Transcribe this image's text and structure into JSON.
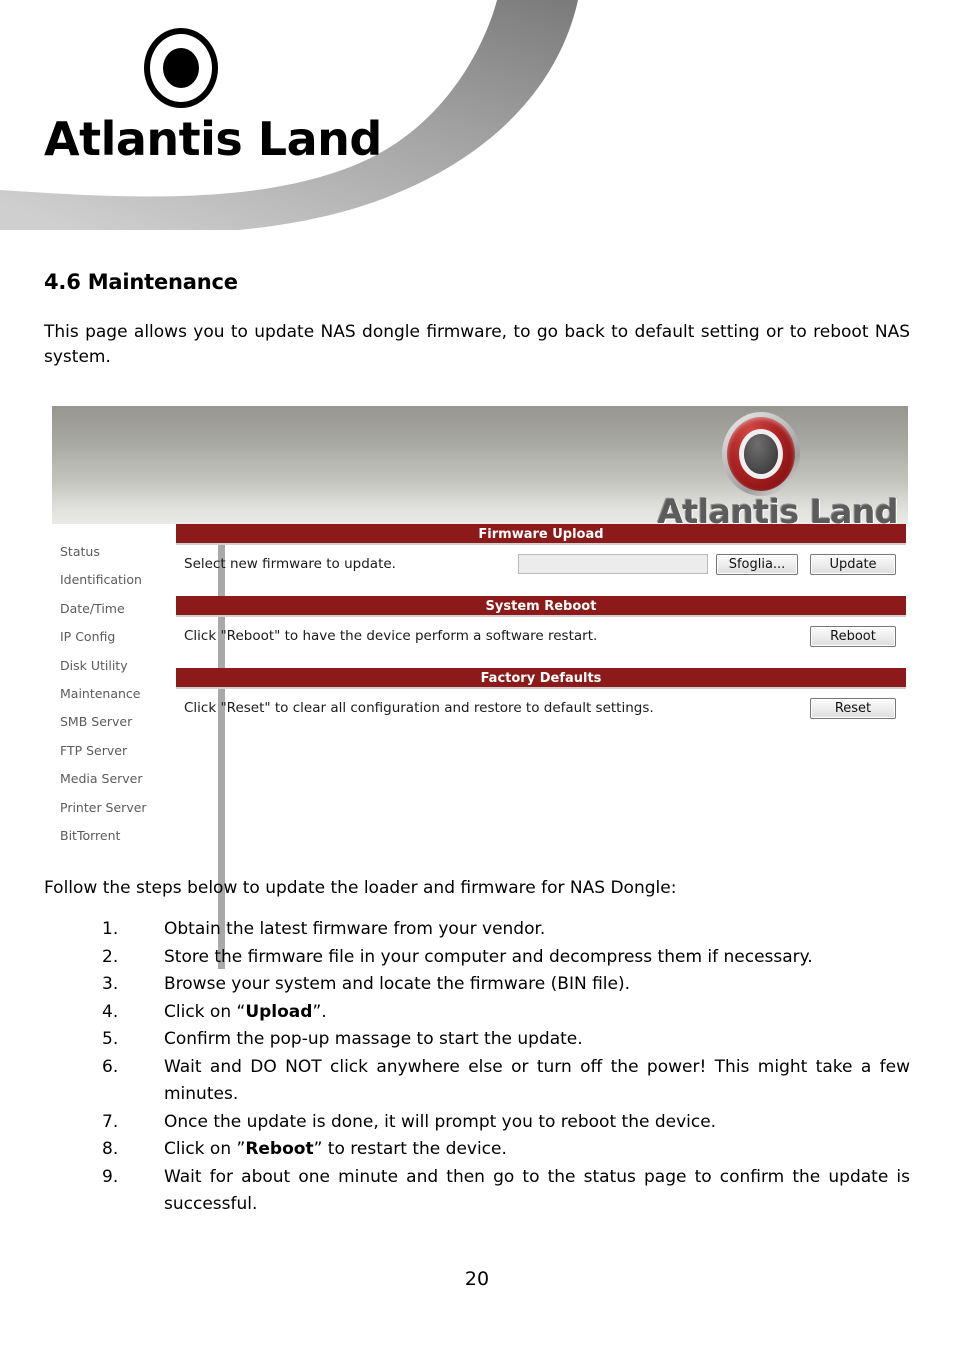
{
  "document": {
    "brand_name": "Atlantis Land",
    "section_title": "4.6 Maintenance",
    "intro_paragraph": "This page allows you to update NAS dongle firmware, to go back to default setting or to reboot NAS system.",
    "steps_intro": "Follow the steps below to update the loader and firmware for NAS Dongle:",
    "page_number": "20",
    "accent_red": "#8d1a1a",
    "swoosh_color": "#a8a8a8"
  },
  "nas_ui": {
    "header": {
      "logo_text": "Atlantis Land",
      "logo_icon": "atlantis-ring-logo"
    },
    "sidebar": {
      "items": [
        {
          "label": "Status"
        },
        {
          "label": "Identification"
        },
        {
          "label": "Date/Time"
        },
        {
          "label": "IP Config"
        },
        {
          "label": "Disk Utility"
        },
        {
          "label": "Maintenance"
        },
        {
          "label": "SMB Server"
        },
        {
          "label": "FTP Server"
        },
        {
          "label": "Media Server"
        },
        {
          "label": "Printer Server"
        },
        {
          "label": "BitTorrent"
        }
      ]
    },
    "panels": {
      "firmware_upload": {
        "title": "Firmware Upload",
        "description": "Select new firmware to update.",
        "file_value": "",
        "file_placeholder": "",
        "browse_label": "Sfoglia...",
        "action_label": "Update"
      },
      "system_reboot": {
        "title": "System Reboot",
        "description": "Click \"Reboot\" to have the device perform a software restart.",
        "action_label": "Reboot"
      },
      "factory_defaults": {
        "title": "Factory Defaults",
        "description": "Click \"Reset\" to clear all configuration and restore to default settings.",
        "action_label": "Reset"
      }
    }
  },
  "steps": [
    {
      "pre": "Obtain the latest firmware from your vendor.",
      "bold": "",
      "post": ""
    },
    {
      "pre": "Store the firmware file in your computer and decompress them if necessary.",
      "bold": "",
      "post": ""
    },
    {
      "pre": "Browse your system and locate the firmware (BIN file).",
      "bold": "",
      "post": ""
    },
    {
      "pre": "Click on “",
      "bold": "Upload",
      "post": "”."
    },
    {
      "pre": "Confirm the pop-up massage to start the update.",
      "bold": "",
      "post": ""
    },
    {
      "pre": "Wait and DO NOT click anywhere else or turn off the power! This might take a few minutes.",
      "bold": "",
      "post": ""
    },
    {
      "pre": "Once the update is done, it will prompt you to reboot the device.",
      "bold": "",
      "post": ""
    },
    {
      "pre": "Click on ”",
      "bold": "Reboot",
      "post": "” to restart the device."
    },
    {
      "pre": "Wait for about one minute and then go to the status page to confirm the update is successful.",
      "bold": "",
      "post": ""
    }
  ]
}
